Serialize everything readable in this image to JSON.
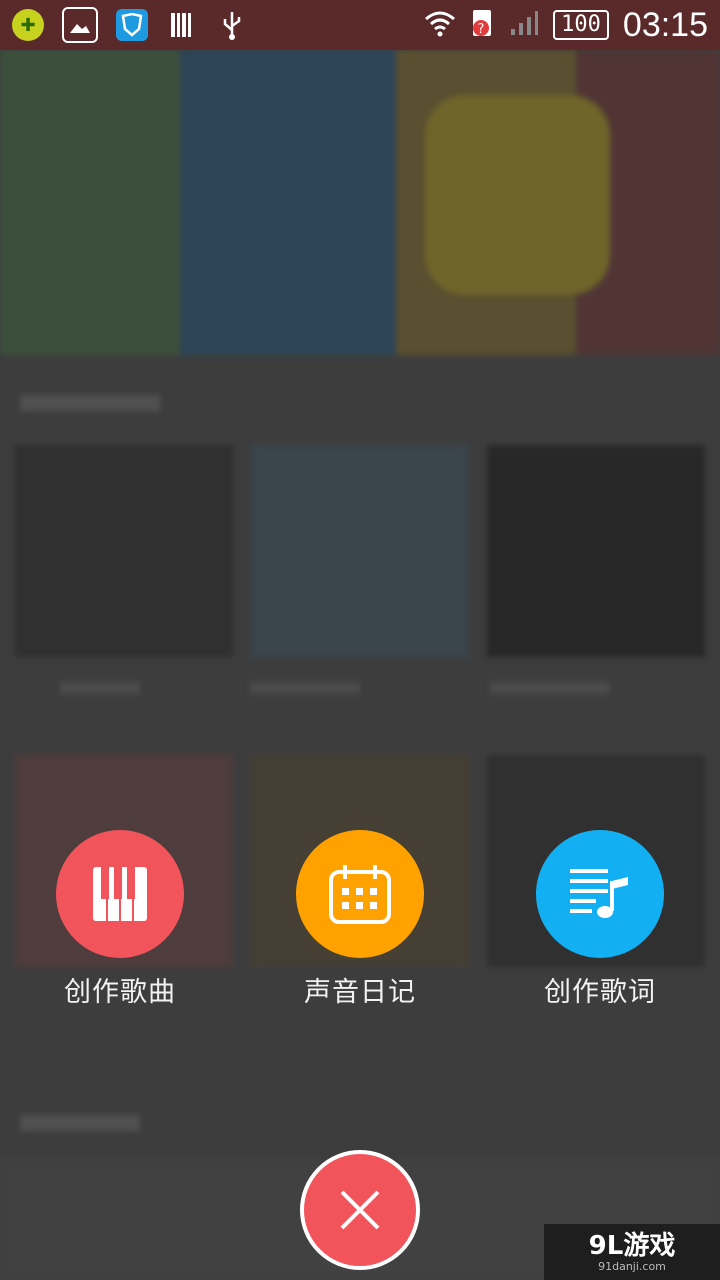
{
  "status_bar": {
    "time": "03:15",
    "battery": "100",
    "icons": [
      "app-icon",
      "gallery-icon",
      "shield-icon",
      "barcode-icon",
      "usb-icon",
      "wifi-icon",
      "sim-alert-icon",
      "signal-icon"
    ]
  },
  "actions": [
    {
      "label": "创作歌曲",
      "icon": "piano-icon",
      "color": "#f2545b"
    },
    {
      "label": "声音日记",
      "icon": "calendar-icon",
      "color": "#ffa200"
    },
    {
      "label": "创作歌词",
      "icon": "lyrics-icon",
      "color": "#12b0f2"
    }
  ],
  "close": {
    "icon": "close-icon",
    "color": "#f2545b"
  },
  "watermark": {
    "brand": "9L游戏",
    "site": "91danji.com"
  }
}
